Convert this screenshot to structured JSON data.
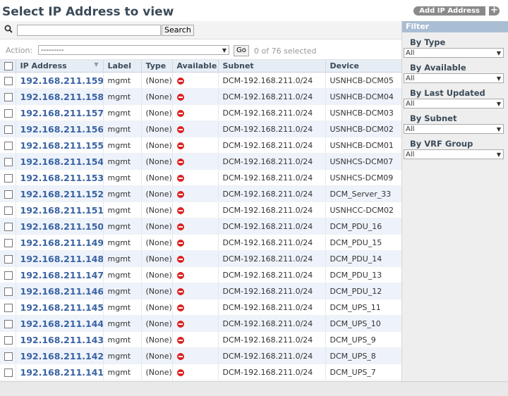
{
  "header": {
    "title": "Select IP Address to view",
    "add_button": "Add IP Address",
    "add_icon": "+"
  },
  "search": {
    "value": "",
    "button": "Search"
  },
  "action": {
    "label": "Action:",
    "value": "---------",
    "go_button": "Go",
    "selected_text": "0 of 76 selected"
  },
  "columns": [
    "IP Address",
    "Label",
    "Type",
    "Available",
    "Subnet",
    "Device"
  ],
  "rows": [
    {
      "ip": "192.168.211.159",
      "label": "mgmt",
      "type": "(None)",
      "subnet": "DCM-192.168.211.0/24",
      "device": "USNHCB-DCM05"
    },
    {
      "ip": "192.168.211.158",
      "label": "mgmt",
      "type": "(None)",
      "subnet": "DCM-192.168.211.0/24",
      "device": "USNHCB-DCM04"
    },
    {
      "ip": "192.168.211.157",
      "label": "mgmt",
      "type": "(None)",
      "subnet": "DCM-192.168.211.0/24",
      "device": "USNHCB-DCM03"
    },
    {
      "ip": "192.168.211.156",
      "label": "mgmt",
      "type": "(None)",
      "subnet": "DCM-192.168.211.0/24",
      "device": "USNHCB-DCM02"
    },
    {
      "ip": "192.168.211.155",
      "label": "mgmt",
      "type": "(None)",
      "subnet": "DCM-192.168.211.0/24",
      "device": "USNHCB-DCM01"
    },
    {
      "ip": "192.168.211.154",
      "label": "mgmt",
      "type": "(None)",
      "subnet": "DCM-192.168.211.0/24",
      "device": "USNHCS-DCM07"
    },
    {
      "ip": "192.168.211.153",
      "label": "mgmt",
      "type": "(None)",
      "subnet": "DCM-192.168.211.0/24",
      "device": "USNHCS-DCM09"
    },
    {
      "ip": "192.168.211.152",
      "label": "mgmt",
      "type": "(None)",
      "subnet": "DCM-192.168.211.0/24",
      "device": "DCM_Server_33"
    },
    {
      "ip": "192.168.211.151",
      "label": "mgmt",
      "type": "(None)",
      "subnet": "DCM-192.168.211.0/24",
      "device": "USNHCC-DCM02"
    },
    {
      "ip": "192.168.211.150",
      "label": "mgmt",
      "type": "(None)",
      "subnet": "DCM-192.168.211.0/24",
      "device": "DCM_PDU_16"
    },
    {
      "ip": "192.168.211.149",
      "label": "mgmt",
      "type": "(None)",
      "subnet": "DCM-192.168.211.0/24",
      "device": "DCM_PDU_15"
    },
    {
      "ip": "192.168.211.148",
      "label": "mgmt",
      "type": "(None)",
      "subnet": "DCM-192.168.211.0/24",
      "device": "DCM_PDU_14"
    },
    {
      "ip": "192.168.211.147",
      "label": "mgmt",
      "type": "(None)",
      "subnet": "DCM-192.168.211.0/24",
      "device": "DCM_PDU_13"
    },
    {
      "ip": "192.168.211.146",
      "label": "mgmt",
      "type": "(None)",
      "subnet": "DCM-192.168.211.0/24",
      "device": "DCM_PDU_12"
    },
    {
      "ip": "192.168.211.145",
      "label": "mgmt",
      "type": "(None)",
      "subnet": "DCM-192.168.211.0/24",
      "device": "DCM_UPS_11"
    },
    {
      "ip": "192.168.211.144",
      "label": "mgmt",
      "type": "(None)",
      "subnet": "DCM-192.168.211.0/24",
      "device": "DCM_UPS_10"
    },
    {
      "ip": "192.168.211.143",
      "label": "mgmt",
      "type": "(None)",
      "subnet": "DCM-192.168.211.0/24",
      "device": "DCM_UPS_9"
    },
    {
      "ip": "192.168.211.142",
      "label": "mgmt",
      "type": "(None)",
      "subnet": "DCM-192.168.211.0/24",
      "device": "DCM_UPS_8"
    },
    {
      "ip": "192.168.211.141",
      "label": "mgmt",
      "type": "(None)",
      "subnet": "DCM-192.168.211.0/24",
      "device": "DCM_UPS_7"
    }
  ],
  "filter": {
    "title": "Filter",
    "groups": [
      {
        "label": "By Type",
        "value": "All"
      },
      {
        "label": "By Available",
        "value": "All"
      },
      {
        "label": "By Last Updated",
        "value": "All"
      },
      {
        "label": "By Subnet",
        "value": "All"
      },
      {
        "label": "By VRF Group",
        "value": "All"
      }
    ]
  },
  "colors": {
    "link": "#3a63a3",
    "unavailable": "#dd2222",
    "filter_header": "#a9bed3"
  }
}
